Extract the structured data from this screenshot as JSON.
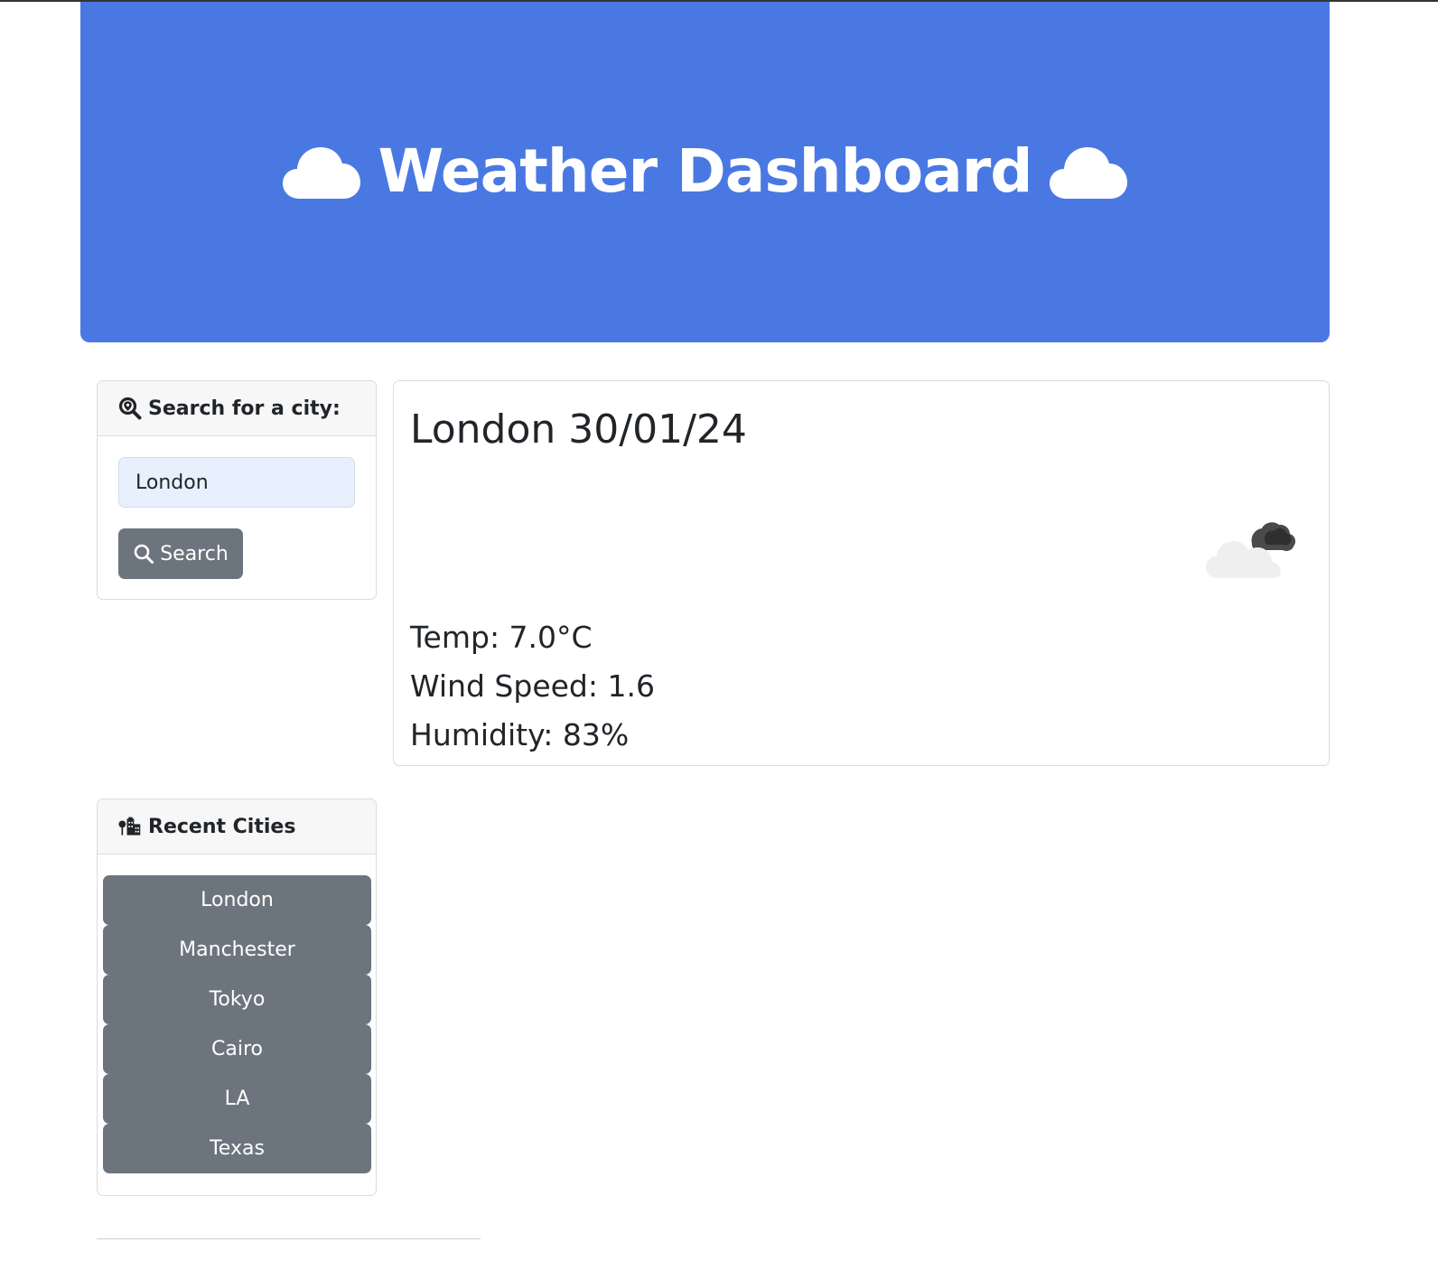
{
  "header": {
    "title": "Weather Dashboard",
    "left_icon": "cloud-icon",
    "right_icon": "cloud-icon",
    "background": "#4a78e3"
  },
  "search": {
    "header_label": "Search for a city:",
    "header_icon": "magnifying-glass-location-icon",
    "input_value": "London",
    "button_label": "Search",
    "button_icon": "search-icon"
  },
  "weather": {
    "title": "London 30/01/24",
    "icon": "broken-clouds-icon",
    "temp": "Temp: 7.0°C",
    "wind": "Wind Speed: 1.6",
    "humidity": "Humidity: 83%"
  },
  "recent": {
    "header_label": "Recent Cities",
    "header_icon": "city-icon",
    "cities": [
      "London",
      "Manchester",
      "Tokyo",
      "Cairo",
      "LA",
      "Texas"
    ]
  },
  "colors": {
    "accent": "#4a78e3",
    "button": "#6c757d",
    "input_bg": "#e8f0fe"
  }
}
